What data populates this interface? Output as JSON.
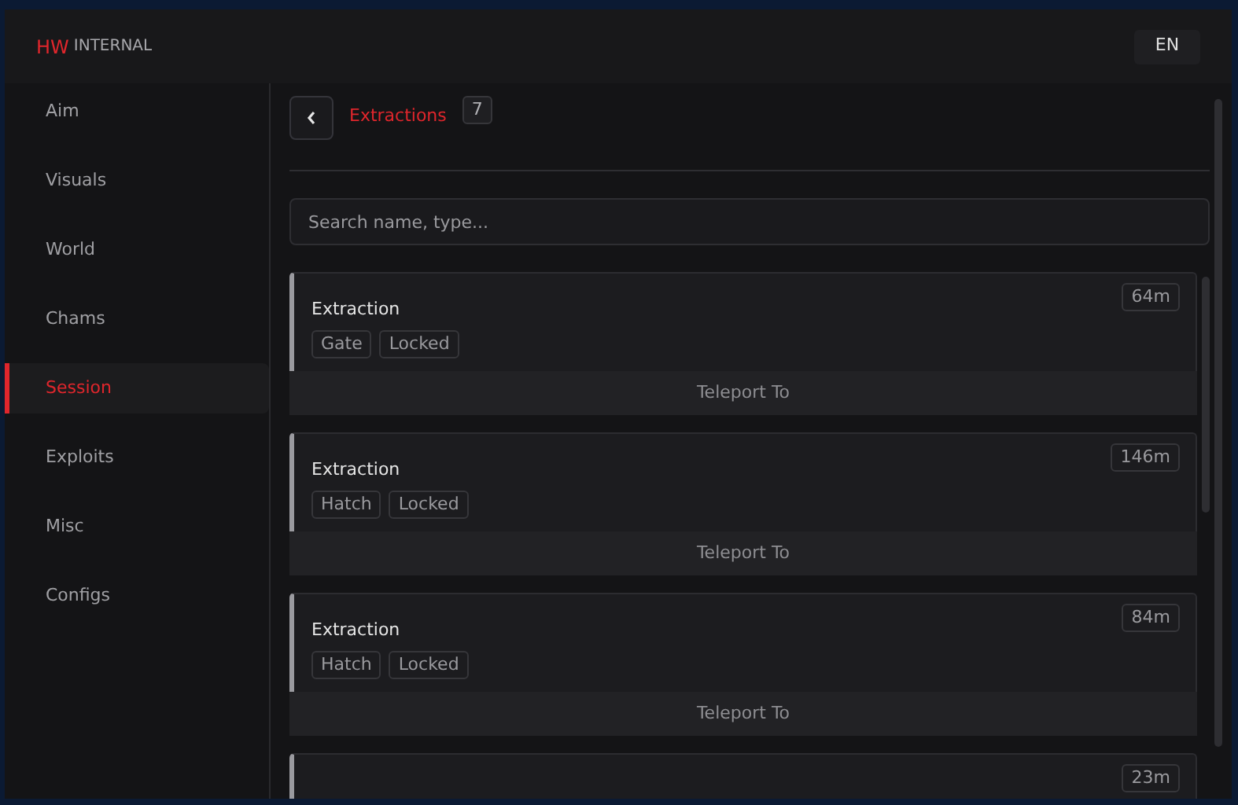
{
  "header": {
    "brand": "HW",
    "title": "INTERNAL",
    "language": "EN"
  },
  "sidebar": {
    "items": [
      {
        "label": "Aim",
        "selected": false
      },
      {
        "label": "Visuals",
        "selected": false
      },
      {
        "label": "World",
        "selected": false
      },
      {
        "label": "Chams",
        "selected": false
      },
      {
        "label": "Session",
        "selected": true
      },
      {
        "label": "Exploits",
        "selected": false
      },
      {
        "label": "Misc",
        "selected": false
      },
      {
        "label": "Configs",
        "selected": false
      }
    ]
  },
  "page": {
    "title": "Extractions",
    "count": "7",
    "search": {
      "placeholder": "Search name, type..."
    }
  },
  "extractions": [
    {
      "name": "Extraction",
      "tags": [
        "Gate",
        "Locked"
      ],
      "distance": "64m",
      "action": "Teleport To"
    },
    {
      "name": "Extraction",
      "tags": [
        "Hatch",
        "Locked"
      ],
      "distance": "146m",
      "action": "Teleport To"
    },
    {
      "name": "Extraction",
      "tags": [
        "Hatch",
        "Locked"
      ],
      "distance": "84m",
      "action": "Teleport To"
    },
    {
      "distance": "23m"
    }
  ]
}
